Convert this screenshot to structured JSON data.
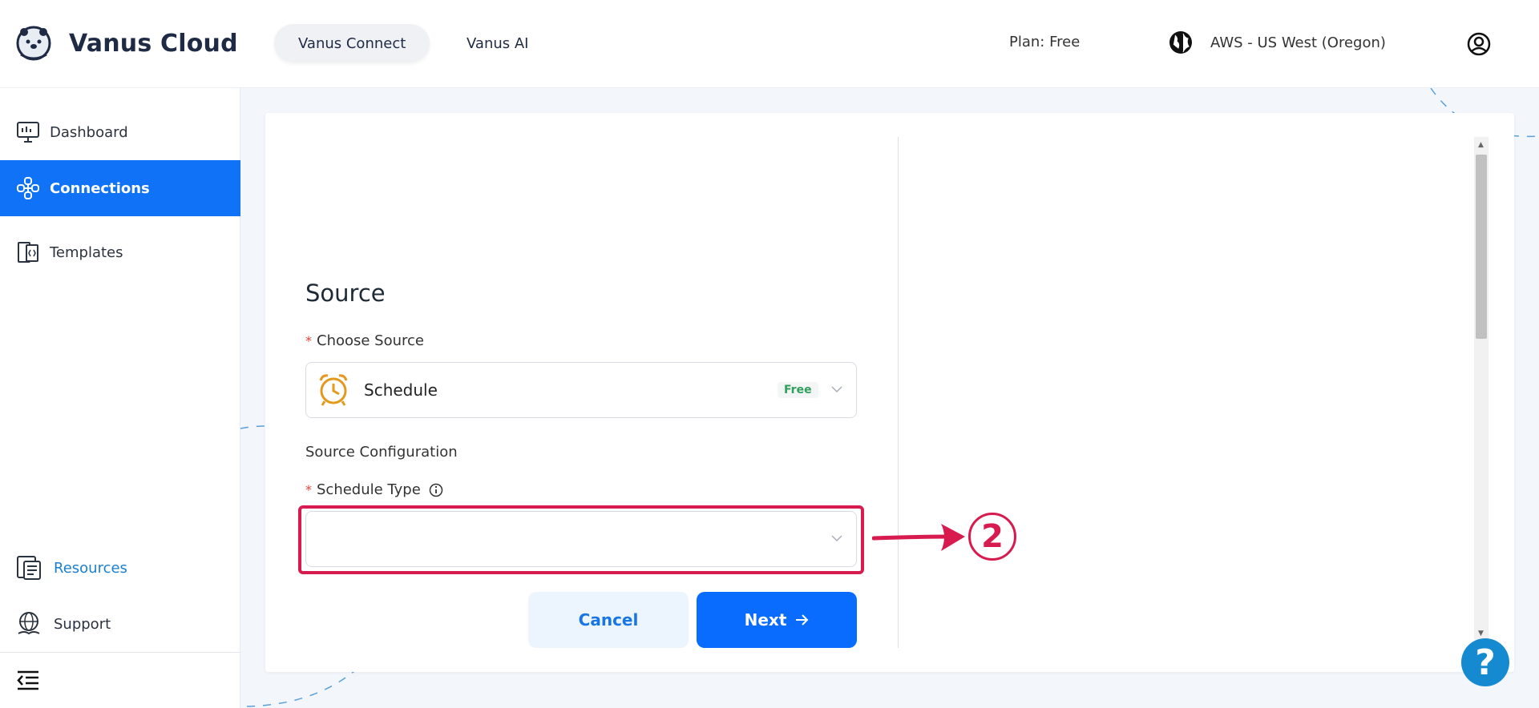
{
  "header": {
    "brand": "Vanus Cloud",
    "tabs": [
      {
        "label": "Vanus Connect",
        "active": true
      },
      {
        "label": "Vanus AI",
        "active": false
      }
    ],
    "plan": "Plan: Free",
    "region": "AWS - US West (Oregon)"
  },
  "sidebar": {
    "items": [
      {
        "label": "Dashboard",
        "icon": "monitor-icon"
      },
      {
        "label": "Connections",
        "icon": "connections-icon",
        "active": true
      },
      {
        "label": "Templates",
        "icon": "templates-icon"
      }
    ],
    "bottom_items": [
      {
        "label": "Resources",
        "icon": "resources-icon"
      },
      {
        "label": "Support",
        "icon": "support-icon"
      }
    ]
  },
  "form": {
    "title": "Source",
    "choose_source_label": "Choose Source",
    "source_value": "Schedule",
    "source_badge": "Free",
    "config_heading": "Source Configuration",
    "schedule_type_label": "Schedule Type",
    "schedule_type_value": ""
  },
  "buttons": {
    "cancel": "Cancel",
    "next": "Next"
  },
  "annotation": {
    "step": "2",
    "color": "#d81b4f"
  },
  "help": {
    "label": "?"
  },
  "colors": {
    "primary": "#0f72f7",
    "accent_red": "#d81b4f",
    "badge_green": "#2e9f5d",
    "alarm_orange": "#e39a1c"
  }
}
